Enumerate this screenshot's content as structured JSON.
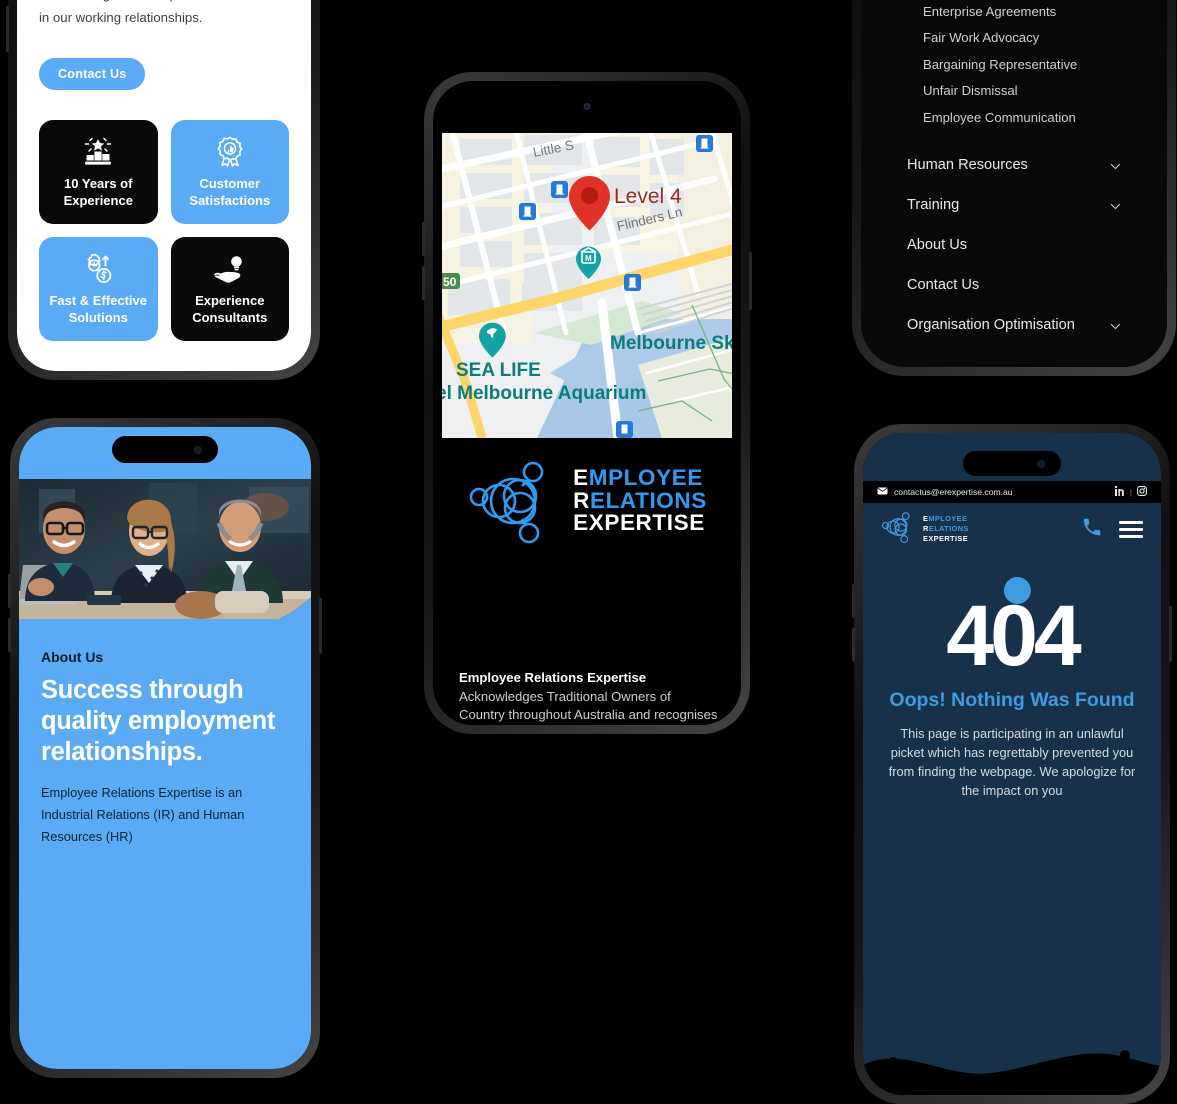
{
  "background_color": "#000000",
  "brand": {
    "accent_blue": "#5aaaf5",
    "logo_blue": "#2f9bf0",
    "dark_navy": "#18314a",
    "black": "#0a0a0a",
    "logo_lines": [
      {
        "first": "E",
        "rest": "MPLOYEE"
      },
      {
        "first": "R",
        "rest": "ELATIONS"
      },
      {
        "first": "",
        "rest": "EXPERTISE"
      }
    ]
  },
  "phone_white": {
    "paragraph": "communication is key to success. So let's all come together and pursue excellence in our working relationships.",
    "contact_button": "Contact Us",
    "cards": [
      {
        "icon": "podium-star-icon",
        "label": "10 Years of Experience",
        "theme": "dark"
      },
      {
        "icon": "award-thumbsup-icon",
        "label": "Customer Satisfactions",
        "theme": "blue"
      },
      {
        "icon": "gear-clock-dollar-icon",
        "label": "Fast & Effective Solutions",
        "theme": "blue"
      },
      {
        "icon": "hand-lightbulb-icon",
        "label": "Experience Consultants",
        "theme": "dark"
      }
    ]
  },
  "phone_map": {
    "map_labels": {
      "pin_label": "Level 4",
      "street_little": "Little ",
      "street_flinders": "Flinders Ln",
      "route_badge": "50",
      "poi_sealife_1": "SEA LIFE",
      "poi_sealife_2": "el Melbourne Aquarium",
      "poi_skydeck": "Melbourne Sky"
    },
    "acknowledgement_title": "Employee Relations Expertise",
    "acknowledgement_body": "Acknowledges Traditional Owners of Country throughout Australia and recognises the continuing connection to lands, waters, and communities. We pay our respect to Aboriginal and Torres Strait Islander cultures; and to Elders"
  },
  "phone_menu": {
    "sub_items": [
      "Enterprise Agreements",
      "Fair Work Advocacy",
      "Bargaining Representative",
      "Unfair Dismissal",
      "Employee Communication"
    ],
    "top_items": [
      {
        "label": "Human Resources",
        "has_chevron": true
      },
      {
        "label": "Training",
        "has_chevron": true
      },
      {
        "label": "About Us",
        "has_chevron": false
      },
      {
        "label": "Contact Us",
        "has_chevron": false
      },
      {
        "label": "Organisation Optimisation",
        "has_chevron": true
      }
    ]
  },
  "phone_about": {
    "hero_alt": "three business people smiling at a meeting table",
    "kicker": "About Us",
    "heading": "Success through quality employment relationships.",
    "paragraph": "Employee Relations Expertise is an Industrial Relations (IR) and Human Resources (HR)"
  },
  "phone_404": {
    "email": "contactus@erexpertise.com.au",
    "mail_icon": "envelope-icon",
    "social_icons": [
      "linkedin-icon",
      "instagram-icon"
    ],
    "phone_icon": "phone-icon",
    "menu_icon": "hamburger-menu-icon",
    "code": "404",
    "heading": "Oops! Nothing Was Found",
    "body": "This page is participating in an unlawful picket which has regrettably prevented you from finding the webpage. We apologize for the impact on you"
  }
}
